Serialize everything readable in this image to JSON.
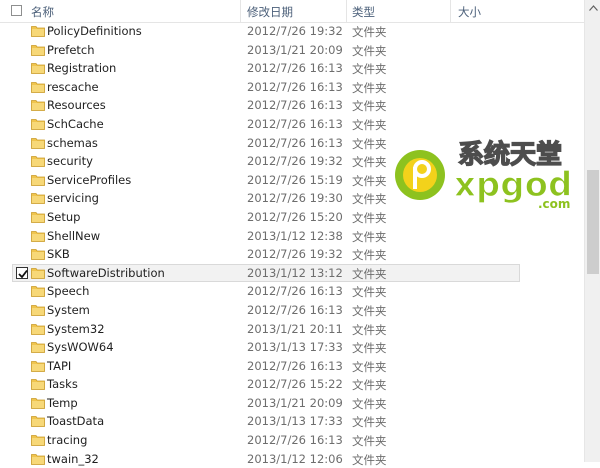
{
  "columns": {
    "name": "名称",
    "modified": "修改日期",
    "type": "类型",
    "size": "大小"
  },
  "rows": [
    {
      "name": "PolicyDefinitions",
      "date": "2012/7/26 19:32",
      "type": "文件夹"
    },
    {
      "name": "Prefetch",
      "date": "2013/1/21 20:09",
      "type": "文件夹"
    },
    {
      "name": "Registration",
      "date": "2012/7/26 16:13",
      "type": "文件夹"
    },
    {
      "name": "rescache",
      "date": "2012/7/26 16:13",
      "type": "文件夹"
    },
    {
      "name": "Resources",
      "date": "2012/7/26 16:13",
      "type": "文件夹"
    },
    {
      "name": "SchCache",
      "date": "2012/7/26 16:13",
      "type": "文件夹"
    },
    {
      "name": "schemas",
      "date": "2012/7/26 16:13",
      "type": "文件夹"
    },
    {
      "name": "security",
      "date": "2012/7/26 19:32",
      "type": "文件夹"
    },
    {
      "name": "ServiceProfiles",
      "date": "2012/7/26 15:19",
      "type": "文件夹"
    },
    {
      "name": "servicing",
      "date": "2012/7/26 19:30",
      "type": "文件夹"
    },
    {
      "name": "Setup",
      "date": "2012/7/26 15:20",
      "type": "文件夹"
    },
    {
      "name": "ShellNew",
      "date": "2013/1/12 12:38",
      "type": "文件夹"
    },
    {
      "name": "SKB",
      "date": "2012/7/26 19:32",
      "type": "文件夹"
    },
    {
      "name": "SoftwareDistribution",
      "date": "2013/1/12 13:12",
      "type": "文件夹"
    },
    {
      "name": "Speech",
      "date": "2012/7/26 16:13",
      "type": "文件夹"
    },
    {
      "name": "System",
      "date": "2012/7/26 16:13",
      "type": "文件夹"
    },
    {
      "name": "System32",
      "date": "2013/1/21 20:11",
      "type": "文件夹"
    },
    {
      "name": "SysWOW64",
      "date": "2013/1/13 17:33",
      "type": "文件夹"
    },
    {
      "name": "TAPI",
      "date": "2012/7/26 16:13",
      "type": "文件夹"
    },
    {
      "name": "Tasks",
      "date": "2012/7/26 15:22",
      "type": "文件夹"
    },
    {
      "name": "Temp",
      "date": "2013/1/21 20:09",
      "type": "文件夹"
    },
    {
      "name": "ToastData",
      "date": "2013/1/13 17:33",
      "type": "文件夹"
    },
    {
      "name": "tracing",
      "date": "2012/7/26 16:13",
      "type": "文件夹"
    },
    {
      "name": "twain_32",
      "date": "2013/1/12 12:06",
      "type": "文件夹"
    }
  ],
  "selected_index": 13,
  "watermark": {
    "text_cn": "系统天堂",
    "text_en": "xpgod",
    "domain": ".com"
  },
  "colors": {
    "folder": "#f0c54e",
    "header_text": "#4c607a",
    "logo_green": "#8dc21f",
    "logo_yellow": "#f3d21b"
  },
  "icons": {
    "folder": "folder-icon",
    "checkbox": "checkbox-icon",
    "scroll_up": "chevron-up-icon"
  }
}
